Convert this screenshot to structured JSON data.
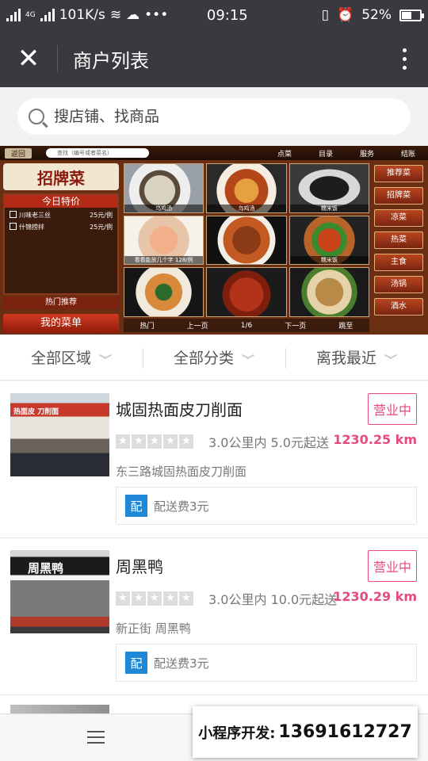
{
  "status_bar": {
    "network": "4G",
    "speed": "101K/s",
    "dots": "•••",
    "time": "09:15",
    "battery": "52%"
  },
  "nav": {
    "title": "商户列表",
    "close_symbol": "✕"
  },
  "search": {
    "placeholder": "搜店铺、找商品"
  },
  "banner": {
    "back": "返回",
    "search_hint": "查找（编号或者菜名）",
    "menu": [
      "点菜",
      "目录",
      "服务",
      "结账"
    ],
    "logo": "招牌菜",
    "special_title": "今日特价",
    "special_items": [
      {
        "name": "川味老三丝",
        "price": "25元/例"
      },
      {
        "name": "什锦捞拌",
        "price": "25元/例"
      }
    ],
    "hot": "热门推荐",
    "my_menu": "我的菜单",
    "dish_captions": [
      "乌鸡汤",
      "乌鸡汤",
      "糯米饭",
      "",
      "",
      "糯米饭",
      "",
      "",
      ""
    ],
    "dish_note": "看看能放几个字 128/例",
    "pager": {
      "hot": "热门",
      "prev": "上一页",
      "page": "1/6",
      "next": "下一页",
      "jump": "跳至"
    },
    "categories": [
      "推荐菜",
      "招牌菜",
      "凉菜",
      "热菜",
      "主食",
      "汤锅",
      "酒水"
    ]
  },
  "filters": [
    "全部区域",
    "全部分类",
    "离我最近"
  ],
  "stores": [
    {
      "name": "城固热面皮刀削面",
      "status": "营业中",
      "meta": "3.0公里内 5.0元起送",
      "distance": "1230.25 km",
      "address": "东三路城固热面皮刀削面",
      "delivery_badge": "配",
      "delivery": "配送费3元",
      "sign_text": "热面皮 刀削面"
    },
    {
      "name": "周黑鸭",
      "status": "营业中",
      "meta": "3.0公里内 10.0元起送",
      "distance": "1230.29 km",
      "address": "新正街 周黑鸭",
      "delivery_badge": "配",
      "delivery": "配送费3元",
      "sign_text": "周黑鸭"
    }
  ],
  "ad": {
    "label": "小程序开发:",
    "number": "13691612727"
  },
  "colors": {
    "nav": "#393a3f",
    "accent": "#e64b7c",
    "badge": "#1e88d6"
  }
}
